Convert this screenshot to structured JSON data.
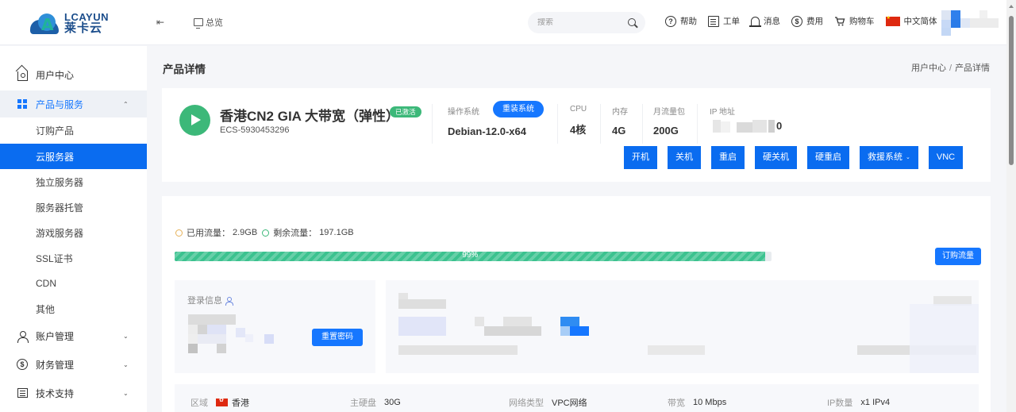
{
  "header": {
    "logo_en": "LCAYUN",
    "logo_cn": "莱卡云",
    "overview_label": "总览",
    "search_placeholder": "搜索",
    "links": [
      {
        "icon": "help-icon",
        "glyph": "?",
        "label": "帮助"
      },
      {
        "icon": "ticket-icon",
        "glyph": "",
        "label": "工单"
      },
      {
        "icon": "bell-icon",
        "glyph": "",
        "label": "消息"
      },
      {
        "icon": "dollar-icon",
        "glyph": "$",
        "label": "费用"
      },
      {
        "icon": "cart-icon",
        "glyph": "🛒",
        "label": "购物车"
      }
    ],
    "language_label": "中文简体"
  },
  "sidebar": {
    "items": [
      {
        "label": "用户中心",
        "icon": "home-icon"
      },
      {
        "label": "产品与服务",
        "icon": "grid-icon",
        "expanded": true
      },
      {
        "label": "账户管理",
        "icon": "user-icon"
      },
      {
        "label": "财务管理",
        "icon": "dollar-icon"
      },
      {
        "label": "技术支持",
        "icon": "document-icon"
      }
    ],
    "sub_items": [
      {
        "label": "订购产品"
      },
      {
        "label": "云服务器",
        "active": true
      },
      {
        "label": "独立服务器"
      },
      {
        "label": "服务器托管"
      },
      {
        "label": "游戏服务器"
      },
      {
        "label": "SSL证书"
      },
      {
        "label": "CDN"
      },
      {
        "label": "其他"
      }
    ],
    "chevron_up": "⌃",
    "chevron_down": "⌄"
  },
  "page": {
    "title": "产品详情",
    "breadcrumb": [
      "用户中心",
      "产品详情"
    ],
    "breadcrumb_sep": "/"
  },
  "product": {
    "name": "香港CN2 GIA 大带宽（弹性）",
    "status_badge": "已激活",
    "id": "ECS-5930453296",
    "os_label": "操作系统",
    "reinstall_label": "重装系统",
    "os_value": "Debian-12.0-x64",
    "cpu_label": "CPU",
    "cpu_value": "4核",
    "memory_label": "内存",
    "memory_value": "4G",
    "traffic_pkg_label": "月流量包",
    "traffic_pkg_value": "200G",
    "ip_label": "IP 地址",
    "ip_value_visible_tail": "0",
    "actions": [
      {
        "label": "开机",
        "name": "power-on-button"
      },
      {
        "label": "关机",
        "name": "shutdown-button"
      },
      {
        "label": "重启",
        "name": "restart-button"
      },
      {
        "label": "硬关机",
        "name": "hard-shutdown-button"
      },
      {
        "label": "硬重启",
        "name": "hard-restart-button"
      },
      {
        "label": "救援系统",
        "name": "rescue-system-dropdown",
        "dropdown": true
      },
      {
        "label": "VNC",
        "name": "vnc-button"
      }
    ]
  },
  "traffic": {
    "used_label": "已用流量：",
    "used_value": "2.9GB",
    "remain_label": "剩余流量：",
    "remain_value": "197.1GB",
    "progress_percent": 99,
    "progress_text": "99%",
    "buy_label": "订购流量"
  },
  "login": {
    "title": "登录信息",
    "reset_password_label": "重置密码"
  },
  "specs": [
    {
      "key": "区域",
      "value": "香港",
      "flag": "hk"
    },
    {
      "key": "主硬盘",
      "value": "30G"
    },
    {
      "key": "网络类型",
      "value": "VPC网络"
    },
    {
      "key": "带宽",
      "value": "10 Mbps"
    },
    {
      "key": "IP数量",
      "value": "x1 IPv4"
    }
  ],
  "colors": {
    "primary": "#1677ff",
    "action_blue": "#0a6cf0",
    "success": "#3cb879",
    "progress": "#3cc28f"
  }
}
